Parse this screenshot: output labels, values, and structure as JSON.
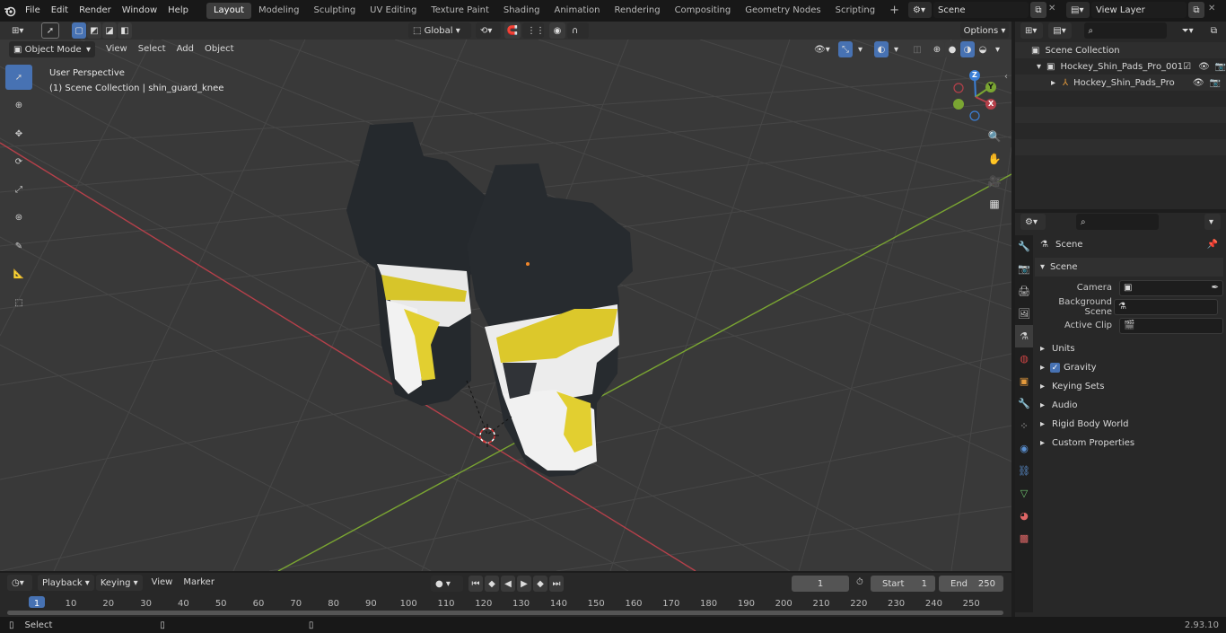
{
  "menu": {
    "items": [
      "File",
      "Edit",
      "Render",
      "Window",
      "Help"
    ]
  },
  "workspaces": [
    {
      "label": "Layout",
      "active": true
    },
    {
      "label": "Modeling"
    },
    {
      "label": "Sculpting"
    },
    {
      "label": "UV Editing"
    },
    {
      "label": "Texture Paint"
    },
    {
      "label": "Shading"
    },
    {
      "label": "Animation"
    },
    {
      "label": "Rendering"
    },
    {
      "label": "Compositing"
    },
    {
      "label": "Geometry Nodes"
    },
    {
      "label": "Scripting"
    }
  ],
  "scene_selector": {
    "value": "Scene"
  },
  "view_layer_selector": {
    "value": "View Layer"
  },
  "viewport_header": {
    "mode": "Object Mode",
    "menus": [
      "View",
      "Select",
      "Add",
      "Object"
    ],
    "transform_orientation": "Global",
    "options": "Options"
  },
  "viewport_overlay": {
    "perspective": "User Perspective",
    "collection": "(1) Scene Collection | shin_guard_knee"
  },
  "gizmo": {
    "z": "Z",
    "y": "Y",
    "x": "X"
  },
  "outliner": {
    "root": "Scene Collection",
    "items": [
      {
        "label": "Hockey_Shin_Pads_Pro_001",
        "level": 1
      },
      {
        "label": "Hockey_Shin_Pads_Pro",
        "level": 2
      }
    ]
  },
  "properties": {
    "header": "Scene",
    "section": "Scene",
    "fields": [
      {
        "label": "Camera"
      },
      {
        "label": "Background Scene"
      },
      {
        "label": "Active Clip"
      }
    ],
    "subpanels": [
      "Units",
      "Gravity",
      "Keying Sets",
      "Audio",
      "Rigid Body World",
      "Custom Properties"
    ]
  },
  "timeline": {
    "menus": [
      "Playback",
      "Keying",
      "View",
      "Marker"
    ],
    "current_frame": "1",
    "start_label": "Start",
    "start": "1",
    "end_label": "End",
    "end": "250",
    "ticks": [
      "1",
      "10",
      "20",
      "30",
      "40",
      "50",
      "60",
      "70",
      "80",
      "90",
      "100",
      "110",
      "120",
      "130",
      "140",
      "150",
      "160",
      "170",
      "180",
      "190",
      "200",
      "210",
      "220",
      "230",
      "240",
      "250"
    ]
  },
  "status": {
    "select": "Select",
    "version": "2.93.10"
  },
  "colors": {
    "accent": "#4772b3",
    "x_axis": "#b5404a",
    "y_axis": "#7aa532",
    "z_axis": "#3b7fd6"
  }
}
